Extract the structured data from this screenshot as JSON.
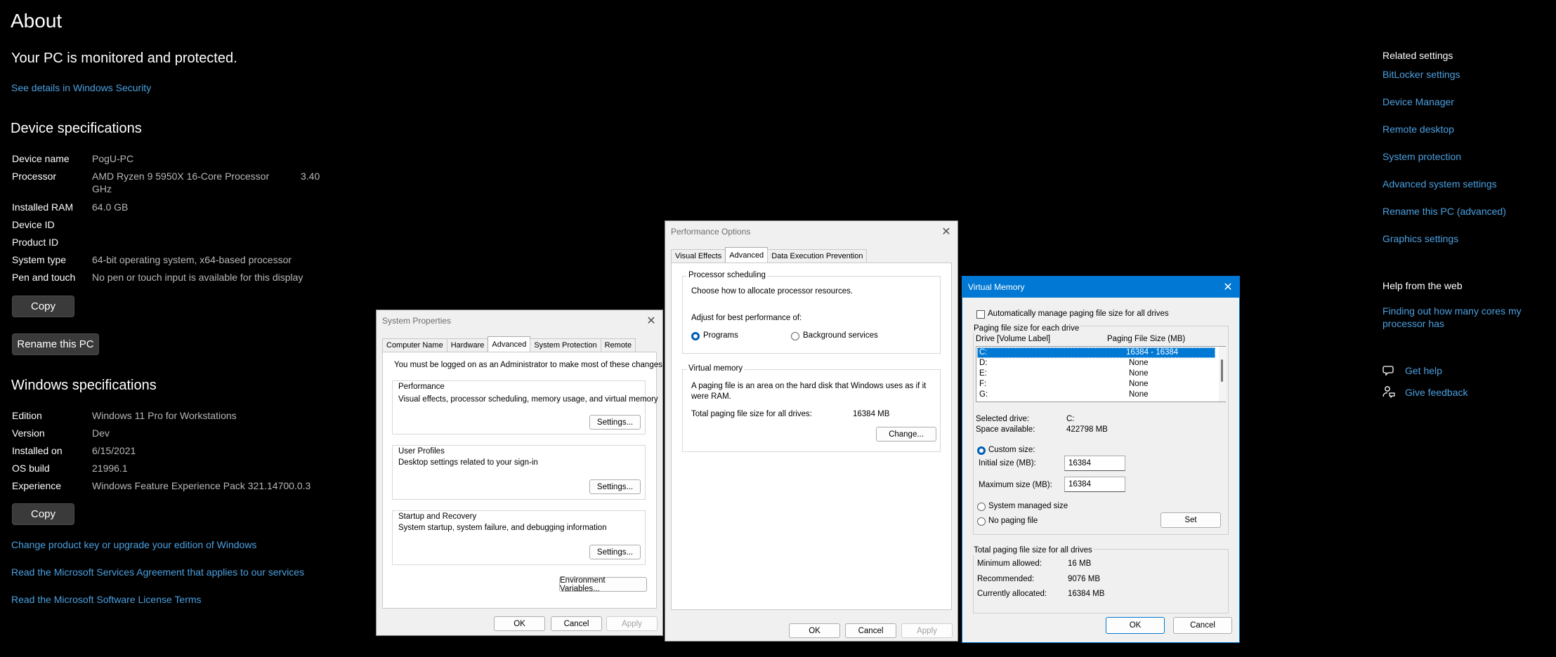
{
  "about": {
    "title": "About",
    "protect_heading": "Your PC is monitored and protected.",
    "security_link": "See details in Windows Security",
    "device_heading": "Device specifications",
    "specs": [
      {
        "label": "Device name",
        "value": "PogU-PC"
      },
      {
        "label": "Processor",
        "value": "AMD Ryzen 9 5950X 16-Core Processor",
        "value2": "GHz",
        "value3": "3.40"
      },
      {
        "label": "Installed RAM",
        "value": "64.0 GB"
      },
      {
        "label": "Device ID",
        "value": ""
      },
      {
        "label": "Product ID",
        "value": ""
      },
      {
        "label": "System type",
        "value": "64-bit operating system, x64-based processor"
      },
      {
        "label": "Pen and touch",
        "value": "No pen or touch input is available for this display"
      }
    ],
    "copy_label": "Copy",
    "rename_label": "Rename this PC",
    "windows_heading": "Windows specifications",
    "winspecs": [
      {
        "label": "Edition",
        "value": "Windows 11 Pro for Workstations"
      },
      {
        "label": "Version",
        "value": "Dev"
      },
      {
        "label": "Installed on",
        "value": "6/15/2021"
      },
      {
        "label": "OS build",
        "value": "21996.1"
      },
      {
        "label": "Experience",
        "value": "Windows Feature Experience Pack 321.14700.0.3"
      }
    ],
    "copy2_label": "Copy",
    "links": [
      "Change product key or upgrade your edition of Windows",
      "Read the Microsoft Services Agreement that applies to our services",
      "Read the Microsoft Software License Terms"
    ]
  },
  "related": {
    "heading": "Related settings",
    "items": [
      "BitLocker settings",
      "Device Manager",
      "Remote desktop",
      "System protection",
      "Advanced system settings",
      "Rename this PC (advanced)",
      "Graphics settings"
    ],
    "help_heading": "Help from the web",
    "help_link": "Finding out how many cores my processor has",
    "get_help": "Get help",
    "feedback": "Give feedback"
  },
  "sysprops": {
    "title": "System Properties",
    "tabs": [
      "Computer Name",
      "Hardware",
      "Advanced",
      "System Protection",
      "Remote"
    ],
    "admin_note": "You must be logged on as an Administrator to make most of these changes.",
    "perf_title": "Performance",
    "perf_desc": "Visual effects, processor scheduling, memory usage, and virtual memory",
    "profiles_title": "User Profiles",
    "profiles_desc": "Desktop settings related to your sign-in",
    "startup_title": "Startup and Recovery",
    "startup_desc": "System startup, system failure, and debugging information",
    "settings_label": "Settings...",
    "env_label": "Environment Variables...",
    "ok": "OK",
    "cancel": "Cancel",
    "apply": "Apply"
  },
  "perfopts": {
    "title": "Performance Options",
    "tabs": [
      "Visual Effects",
      "Advanced",
      "Data Execution Prevention"
    ],
    "sched_title": "Processor scheduling",
    "sched_desc": "Choose how to allocate processor resources.",
    "adjust_label": "Adjust for best performance of:",
    "programs": "Programs",
    "background": "Background services",
    "vm_title": "Virtual memory",
    "vm_desc": "A paging file is an area on the hard disk that Windows uses as if it were RAM.",
    "total_label": "Total paging file size for all drives:",
    "total_value": "16384 MB",
    "change_label": "Change...",
    "ok": "OK",
    "cancel": "Cancel",
    "apply": "Apply"
  },
  "vmem": {
    "title": "Virtual Memory",
    "auto_label": "Automatically manage paging file size for all drives",
    "each_drive": "Paging file size for each drive",
    "col_drive": "Drive  [Volume Label]",
    "col_size": "Paging File Size (MB)",
    "drives": [
      {
        "drive": "C:",
        "size": "16384 - 16384"
      },
      {
        "drive": "D:",
        "size": "None"
      },
      {
        "drive": "E:",
        "size": "None"
      },
      {
        "drive": "F:",
        "size": "None"
      },
      {
        "drive": "G:",
        "size": "None"
      }
    ],
    "selected_label": "Selected drive:",
    "selected_value": "C:",
    "space_label": "Space available:",
    "space_value": "422798 MB",
    "custom_label": "Custom size:",
    "initial_label": "Initial size (MB):",
    "initial_value": "16384",
    "max_label": "Maximum size (MB):",
    "max_value": "16384",
    "system_managed": "System managed size",
    "no_paging": "No paging file",
    "set_label": "Set",
    "total_title": "Total paging file size for all drives",
    "min_label": "Minimum allowed:",
    "min_value": "16 MB",
    "rec_label": "Recommended:",
    "rec_value": "9076 MB",
    "cur_label": "Currently allocated:",
    "cur_value": "16384 MB",
    "ok": "OK",
    "cancel": "Cancel"
  }
}
